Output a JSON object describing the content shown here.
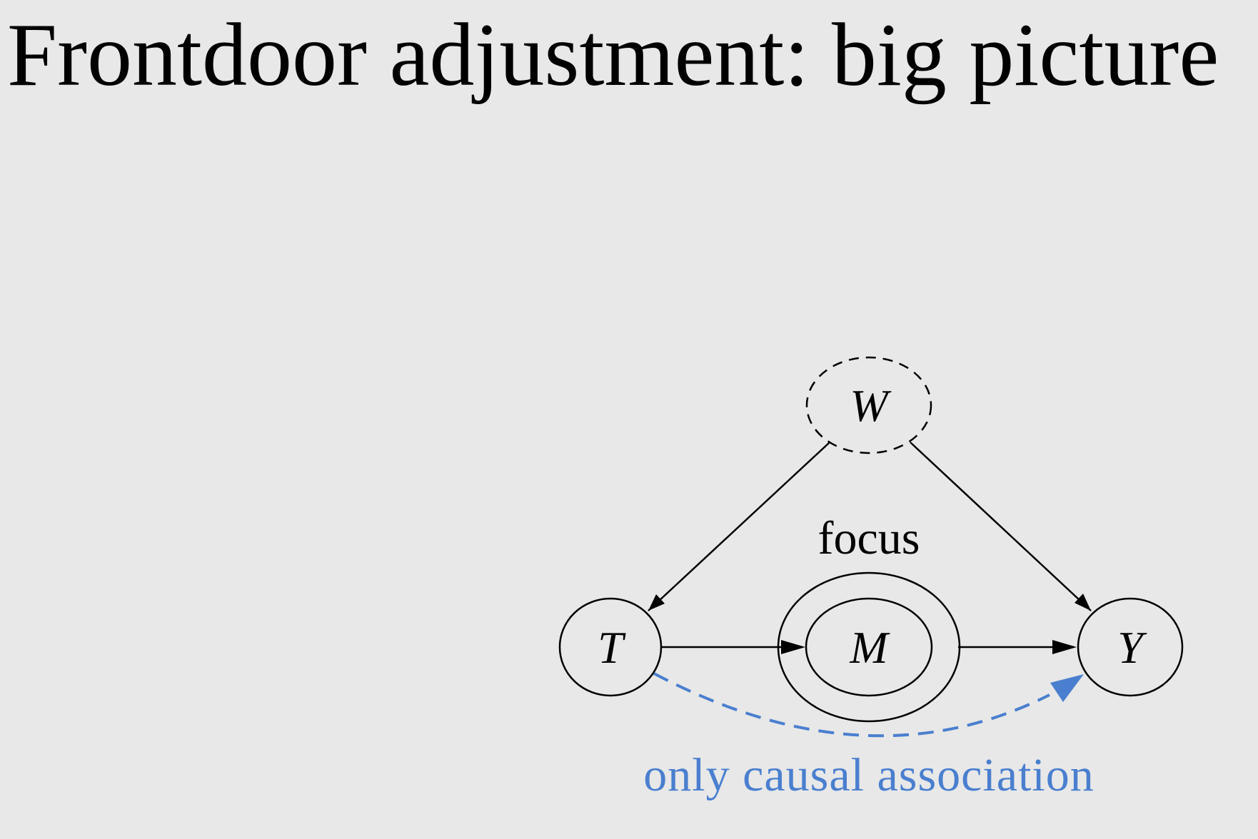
{
  "slide": {
    "title": "Frontdoor adjustment: big picture"
  },
  "diagram": {
    "nodes": [
      {
        "id": "W",
        "label": "W",
        "observed": false
      },
      {
        "id": "T",
        "label": "T",
        "observed": true
      },
      {
        "id": "M",
        "label": "M",
        "observed": true,
        "highlighted": true
      },
      {
        "id": "Y",
        "label": "Y",
        "observed": true
      }
    ],
    "edges": [
      {
        "from": "W",
        "to": "T"
      },
      {
        "from": "W",
        "to": "Y"
      },
      {
        "from": "T",
        "to": "M"
      },
      {
        "from": "M",
        "to": "Y"
      },
      {
        "from": "T",
        "to": "Y",
        "style": "dashed",
        "color": "#4a7fcf"
      }
    ],
    "focus_label": "focus",
    "association_label": "only causal association"
  },
  "colors": {
    "background": "#e8e8e8",
    "ink": "#000000",
    "accent_blue": "#4a7fcf"
  }
}
